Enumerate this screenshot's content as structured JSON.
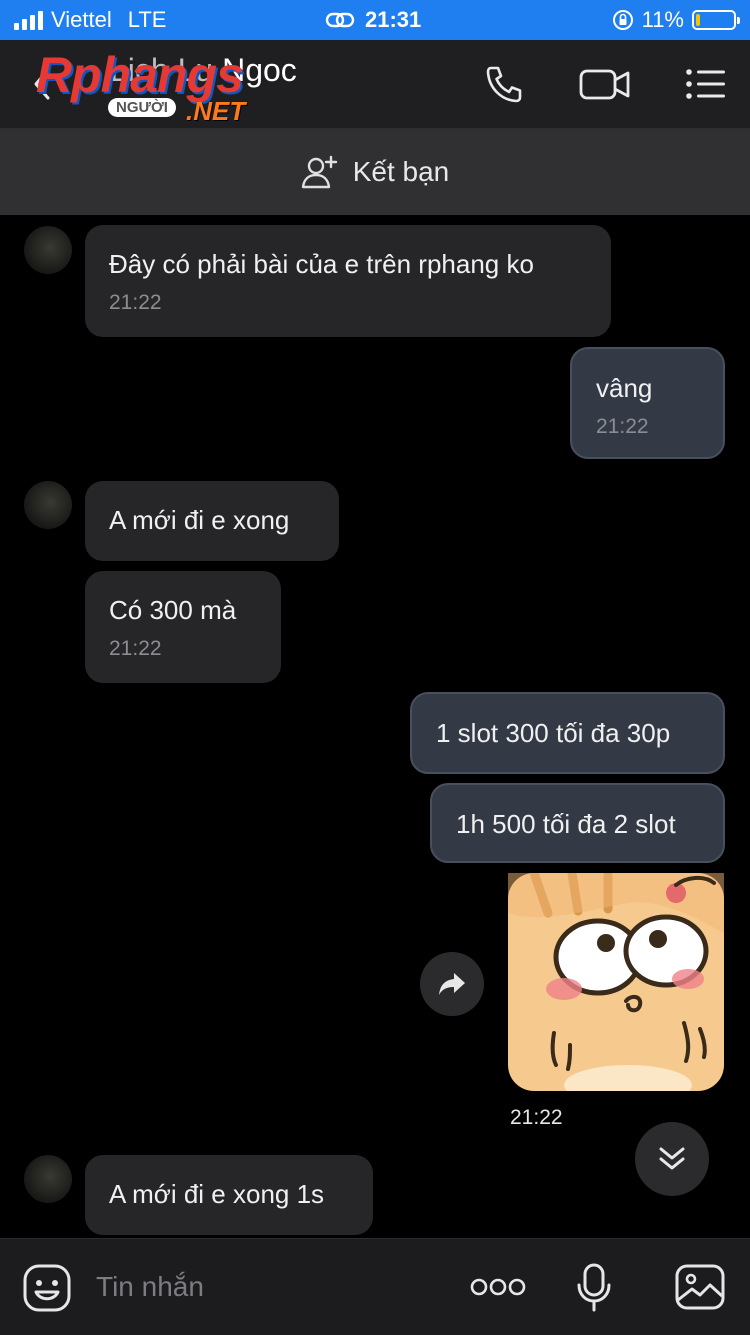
{
  "status_bar": {
    "carrier": "Viettel",
    "network": "LTE",
    "time": "21:31",
    "battery_percent": "11%",
    "battery_level": 0.11,
    "battery_color": "#f5c400",
    "bar_color": "#1f7ef0"
  },
  "header": {
    "contact_name": "Ngoc",
    "watermark": {
      "logo": "Rphangs",
      "sub": "NGƯỜI",
      "net": ".NET"
    },
    "icons": [
      "back-icon",
      "phone-icon",
      "video-call-icon",
      "menu-icon"
    ]
  },
  "friend_bar": {
    "label": "Kết bạn",
    "icon": "add-friend-icon"
  },
  "messages": [
    {
      "side": "in",
      "text": "Đây có phải bài của e trên rphang ko",
      "time": "21:22"
    },
    {
      "side": "out",
      "text": "vâng",
      "time": "21:22"
    },
    {
      "side": "in",
      "text": "A mới đi e xong"
    },
    {
      "side": "in",
      "text": "Có 300 mà",
      "time": "21:22"
    },
    {
      "side": "out",
      "text": "1 slot 300 tối đa 30p"
    },
    {
      "side": "out",
      "text": "1h 500 tối đa 2 slot"
    },
    {
      "side": "out",
      "type": "sticker",
      "sticker": "surprised-cat-sticker",
      "time": "21:22"
    },
    {
      "side": "in",
      "text": "A mới đi e xong 1s"
    }
  ],
  "input_bar": {
    "placeholder": "Tin nhắn",
    "icons": [
      "emoji-icon",
      "more-icon",
      "microphone-icon",
      "image-icon"
    ]
  },
  "colors": {
    "background": "#000000",
    "incoming_bubble": "#262628",
    "outgoing_bubble": "#333a46",
    "header": "#1f1f21"
  }
}
